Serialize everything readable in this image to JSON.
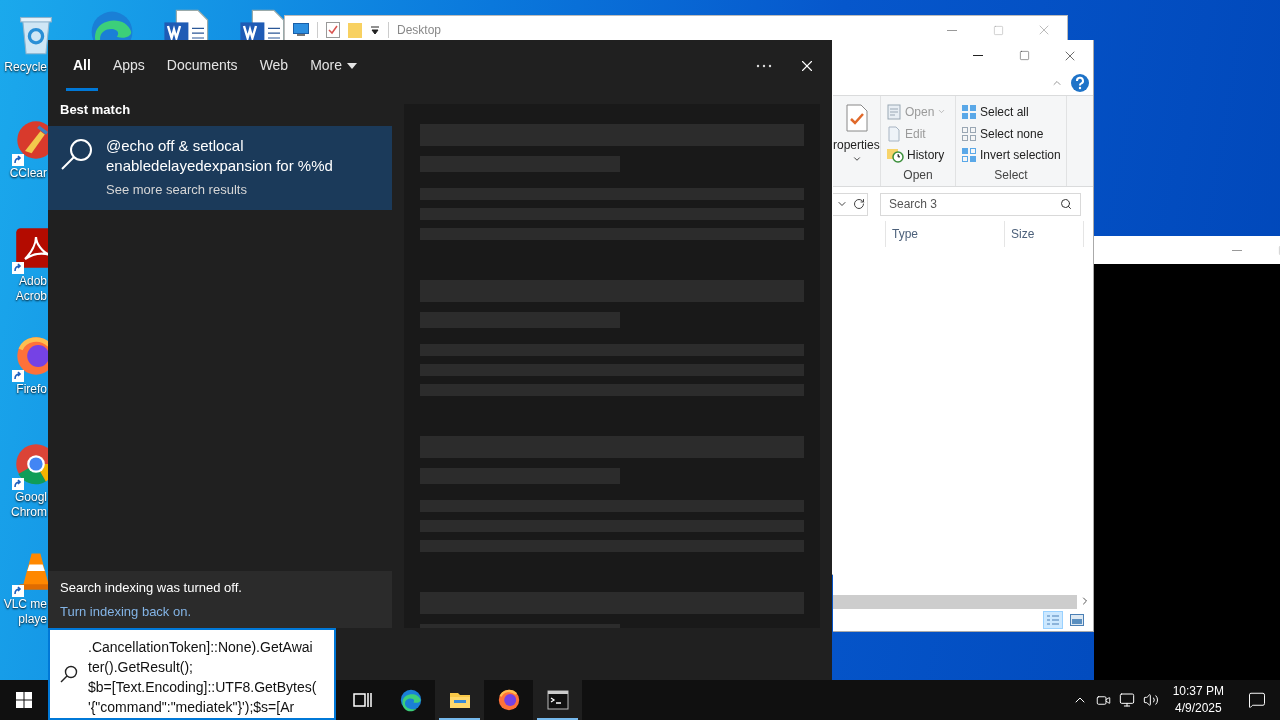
{
  "desktop_icons": [
    {
      "kind": "recycle-bin",
      "label": "Recycle",
      "shortcut": false
    },
    {
      "kind": "ccleaner",
      "label": "CClear",
      "shortcut": true
    },
    {
      "kind": "acrobat",
      "label": "Adob Acrob",
      "shortcut": true
    },
    {
      "kind": "firefox",
      "label": "Firefo",
      "shortcut": true
    },
    {
      "kind": "chrome",
      "label": "Googl Chrom",
      "shortcut": true
    },
    {
      "kind": "vlc",
      "label": "VLC me playe",
      "shortcut": true
    }
  ],
  "top_icons": [
    {
      "kind": "edge"
    },
    {
      "kind": "word"
    },
    {
      "kind": "word"
    }
  ],
  "back_window": {
    "title": "Desktop"
  },
  "explorer": {
    "properties_label": "roperties",
    "groups": [
      {
        "label": "Open",
        "items": [
          {
            "kind": "open",
            "label": "Open",
            "disabled": true,
            "dropdown": true
          },
          {
            "kind": "edit",
            "label": "Edit",
            "disabled": true,
            "dropdown": false
          },
          {
            "kind": "history",
            "label": "History",
            "disabled": false,
            "dropdown": false
          }
        ]
      },
      {
        "label": "Select",
        "items": [
          {
            "kind": "select-all",
            "label": "Select all",
            "disabled": false,
            "dropdown": false
          },
          {
            "kind": "select-none",
            "label": "Select none",
            "disabled": false,
            "dropdown": false
          },
          {
            "kind": "invert",
            "label": "Invert selection",
            "disabled": false,
            "dropdown": false
          }
        ]
      }
    ],
    "search_placeholder": "Search 3",
    "columns": [
      "Type",
      "Size"
    ],
    "views": [
      {
        "kind": "details",
        "selected": true
      },
      {
        "kind": "large-icons",
        "selected": false
      }
    ]
  },
  "search_panel": {
    "tabs": [
      {
        "label": "All",
        "selected": true,
        "dropdown": false
      },
      {
        "label": "Apps",
        "selected": false,
        "dropdown": false
      },
      {
        "label": "Documents",
        "selected": false,
        "dropdown": false
      },
      {
        "label": "Web",
        "selected": false,
        "dropdown": false
      },
      {
        "label": "More",
        "selected": false,
        "dropdown": true
      }
    ],
    "best_match": {
      "heading": "Best match",
      "title": "@echo off & setlocal enabledelayedexpansion for %%d",
      "subtitle": "See more search results"
    },
    "notice": {
      "text": "Search indexing was turned off.",
      "link": "Turn indexing back on."
    }
  },
  "search_box": {
    "value_lines": [
      ".CancellationToken]::None).GetAwai",
      "ter().GetResult();",
      "$b=[Text.Encoding]::UTF8.GetBytes(",
      "'{\"command\":\"mediatek\"}');$s=[Ar"
    ]
  },
  "taskbar": {
    "apps": [
      {
        "kind": "task-view",
        "active": false
      },
      {
        "kind": "edge",
        "active": false
      },
      {
        "kind": "explorer",
        "active": true
      },
      {
        "kind": "firefox",
        "active": false
      },
      {
        "kind": "terminal",
        "active": true
      }
    ],
    "time": "10:37 PM",
    "date": "4/9/2025"
  }
}
